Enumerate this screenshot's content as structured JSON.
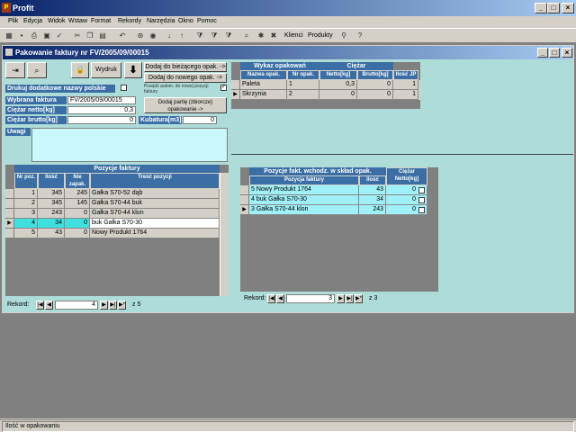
{
  "app": {
    "title": "Profit"
  },
  "menu": [
    "Plik",
    "Edycja",
    "Widok",
    "Wstaw",
    "Format",
    "Rekordy",
    "Narzędzia",
    "Okno",
    "Pomoc"
  ],
  "toolbar": {
    "klienci": "Klienci",
    "produkty": "Produkty"
  },
  "window": {
    "title": "Pakowanie faktury nr FV/2005/09/00015"
  },
  "buttons": {
    "wydruk": "Wydruk",
    "add_current": "Dodaj do bieżącego opak. ->",
    "add_new": "Dodaj do nowego opak. ->",
    "auto_pack": "Przejdź autom. do nowej pozycji faktury",
    "add_part": "Dodaj partię (zbiorcze) opakowanie ->"
  },
  "form": {
    "print_names_label": "Drukuj dodatkowe nazwy polskie",
    "invoice_label": "Wybrana faktura",
    "invoice_value": "FV/2005/09/00015",
    "netto_label": "Ciężar netto[kg]",
    "netto_value": "0,3",
    "brutto_label": "Ciężar brutto[kg]",
    "brutto_value": "0",
    "kubatura_label": "Kubatura[m3]:",
    "kubatura_value": "0",
    "uwagi_label": "Uwagi"
  },
  "packages": {
    "caption_left": "Wykaz opakowań",
    "caption_right": "Ciężar",
    "headers": [
      "Nazwa opak.",
      "Nr opak.",
      "Netto[kg]",
      "Brutto[kg]",
      "Ilość JP"
    ],
    "rows": [
      {
        "name": "Paleta",
        "nr": "1",
        "netto": "0,3",
        "brutto": "0",
        "ilosc": "1"
      },
      {
        "name": "Skrzynia",
        "nr": "2",
        "netto": "0",
        "brutto": "0",
        "ilosc": "1"
      }
    ]
  },
  "invoice_items": {
    "caption": "Pozycje faktury",
    "headers": [
      "Nr poz.",
      "Ilość",
      "Nie zapak.",
      "Treść pozycji"
    ],
    "rows": [
      {
        "nr": "1",
        "ilosc": "345",
        "nie": "245",
        "tresc": "Gałka S70-52 dąb"
      },
      {
        "nr": "2",
        "ilosc": "345",
        "nie": "145",
        "tresc": "Gałka S70-44 buk"
      },
      {
        "nr": "3",
        "ilosc": "243",
        "nie": "0",
        "tresc": "Gałka S70-44 klon"
      },
      {
        "nr": "4",
        "ilosc": "34",
        "nie": "0",
        "tresc": "buk Gałka S70-30"
      },
      {
        "nr": "5",
        "ilosc": "43",
        "nie": "0",
        "tresc": "Nowy Produkt 1764"
      }
    ],
    "nav": {
      "label": "Rekord:",
      "current": "4",
      "total": "z 5"
    }
  },
  "package_items": {
    "caption": "Pozycje fakt. wchodz. w skład opak.",
    "caption_right": "Ciężar Netto[kg]",
    "headers": [
      "Pozycja faktury",
      "Ilość"
    ],
    "rows": [
      {
        "pozycja": "5 Nowy Produkt 1764",
        "ilosc": "43",
        "netto": "0"
      },
      {
        "pozycja": "4 buk Gałka S70-30",
        "ilosc": "34",
        "netto": "0"
      },
      {
        "pozycja": "3 Gałka S70-44 klon",
        "ilosc": "243",
        "netto": "0"
      }
    ],
    "nav": {
      "label": "Rekord:",
      "current": "3",
      "total": "z 3"
    }
  },
  "status": {
    "text": "Ilość w opakowaniu"
  },
  "colors": {
    "title": "#0a246a",
    "header": "#3a6ea5",
    "selected_row": "#40e0e0",
    "highlight_row": "#a0f0f8",
    "background": "#aedcd8"
  },
  "icons": [
    "app-icon",
    "view-icon",
    "search-icon",
    "lock-icon",
    "arrow-down-icon",
    "binoculars-icon",
    "help-icon"
  ]
}
